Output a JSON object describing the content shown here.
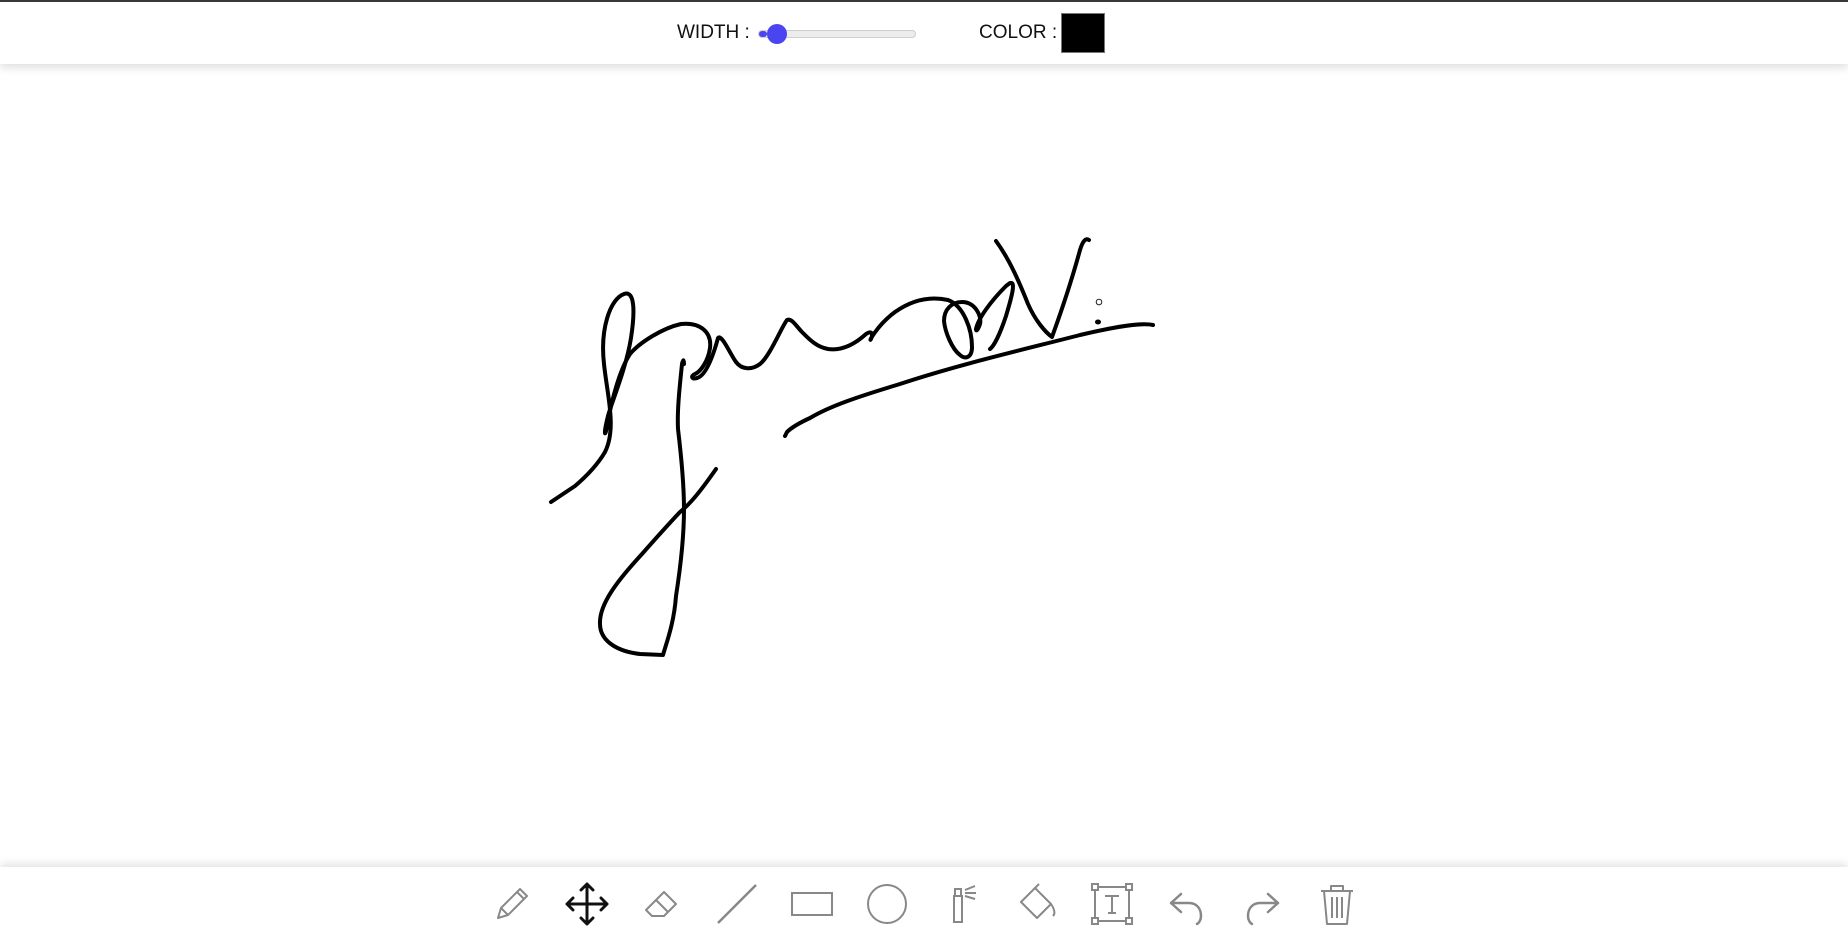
{
  "toolbar": {
    "width_label": "WIDTH :",
    "width_value_fraction": 0.05,
    "color_label": "COLOR :",
    "color_value": "#000000",
    "slider_accent": "#4a45f0"
  },
  "tools": [
    {
      "name": "pencil-icon",
      "active": false
    },
    {
      "name": "move-icon",
      "active": true
    },
    {
      "name": "eraser-icon",
      "active": false
    },
    {
      "name": "line-icon",
      "active": false
    },
    {
      "name": "rectangle-icon",
      "active": false
    },
    {
      "name": "circle-icon",
      "active": false
    },
    {
      "name": "spray-icon",
      "active": false
    },
    {
      "name": "fill-bucket-icon",
      "active": false
    },
    {
      "name": "text-icon",
      "active": false
    },
    {
      "name": "undo-icon",
      "active": false
    },
    {
      "name": "redo-icon",
      "active": false
    },
    {
      "name": "trash-icon",
      "active": false
    }
  ]
}
